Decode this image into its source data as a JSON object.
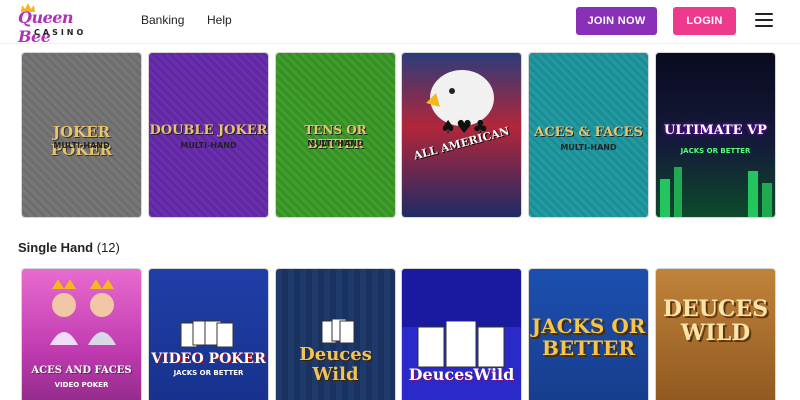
{
  "header": {
    "logo_line1": "Queen Bee",
    "logo_line2": "CASINO",
    "nav": [
      "Banking",
      "Help"
    ],
    "join_label": "JOIN NOW",
    "login_label": "LOGIN"
  },
  "colors": {
    "join": "#8a30b8",
    "login": "#ee3a8c",
    "brand": "#b130b8"
  },
  "multi_hand_games": [
    {
      "title": "JOKER POKER",
      "sub": "MULTI-HAND"
    },
    {
      "title": "DOUBLE JOKER",
      "sub": "MULTI-HAND"
    },
    {
      "title": "TENS OR BETTER",
      "sub": "MULTI-HAND"
    },
    {
      "title": "ALL AMERICAN",
      "sub": ""
    },
    {
      "title": "ACES & FACES",
      "sub": "MULTI-HAND"
    },
    {
      "title": "ULTIMATE VP",
      "sub": "JACKS OR BETTER"
    }
  ],
  "single_hand": {
    "label": "Single Hand",
    "count": "(12)",
    "games": [
      {
        "title": "ACES AND FACES",
        "sub": "VIDEO POKER"
      },
      {
        "title": "VIDEO POKER",
        "sub": "JACKS OR BETTER"
      },
      {
        "title": "Deuces Wild",
        "sub": ""
      },
      {
        "title": "DeucesWild",
        "sub": ""
      },
      {
        "title": "JACKS OR BETTER",
        "sub": ""
      },
      {
        "title": "DEUCES WILD",
        "sub": ""
      }
    ]
  }
}
